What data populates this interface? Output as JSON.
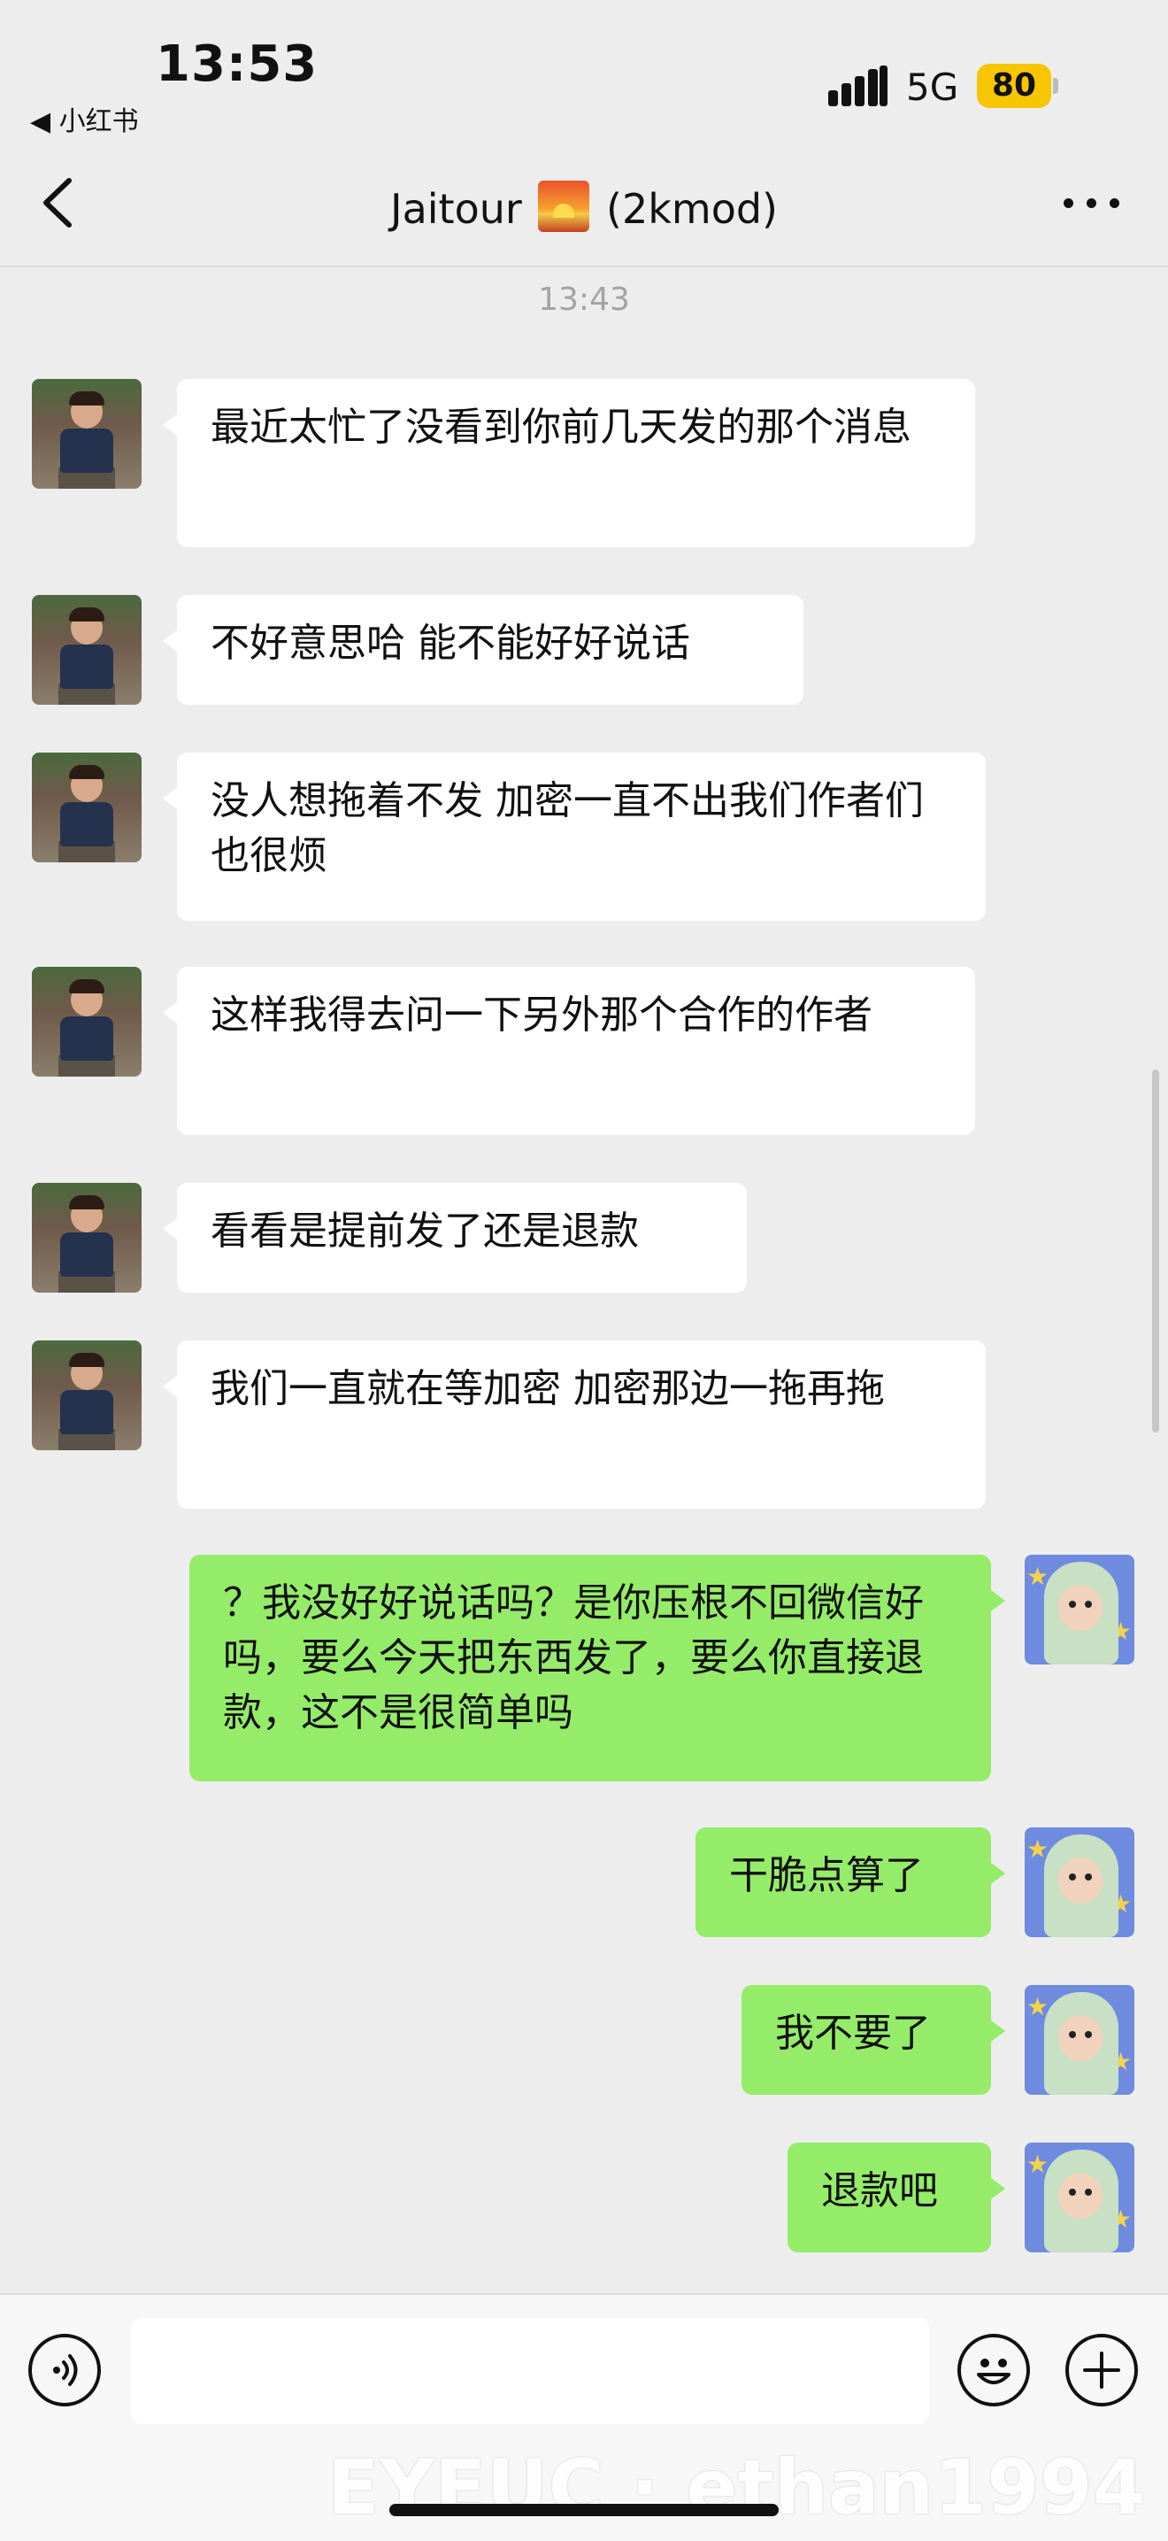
{
  "status_bar": {
    "time": "13:53",
    "back_app": "◀ 小红书",
    "network": "5G",
    "battery": "80"
  },
  "nav": {
    "title": "Jaitour",
    "subtitle": "(2kmod)",
    "emoji": "sunrise-emoji"
  },
  "chat": {
    "timestamp": "13:43",
    "messages": [
      {
        "side": "in",
        "text": "最近太忙了没看到你前几天发的那个消息"
      },
      {
        "side": "in",
        "text": "不好意思哈 能不能好好说话"
      },
      {
        "side": "in",
        "text": "没人想拖着不发 加密一直不出我们作者们也很烦"
      },
      {
        "side": "in",
        "text": "这样我得去问一下另外那个合作的作者"
      },
      {
        "side": "in",
        "text": "看看是提前发了还是退款"
      },
      {
        "side": "in",
        "text": "我们一直就在等加密 加密那边一拖再拖"
      },
      {
        "side": "out",
        "text": "？我没好好说话吗？是你压根不回微信好吗，要么今天把东西发了，要么你直接退款，这不是很简单吗"
      },
      {
        "side": "out",
        "text": "干脆点算了"
      },
      {
        "side": "out",
        "text": "我不要了"
      },
      {
        "side": "out",
        "text": "退款吧"
      }
    ]
  },
  "input_bar": {
    "value": "",
    "placeholder": ""
  },
  "watermark": "EYEUC · ethan1994",
  "colors": {
    "background": "#ededed",
    "bubble_in": "#ffffff",
    "bubble_out": "#95ec69",
    "battery": "#f7c600"
  }
}
